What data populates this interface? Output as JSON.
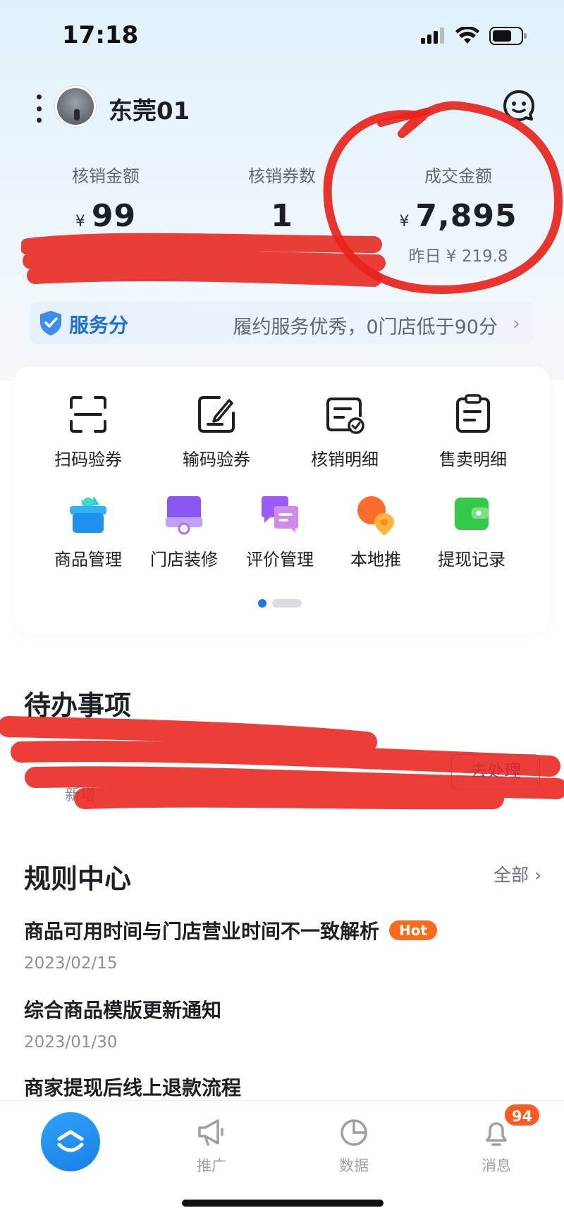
{
  "status_bar": {
    "time": "17:18",
    "icons": [
      "signal-icon",
      "wifi-icon",
      "battery-icon"
    ]
  },
  "header": {
    "store_name": "东莞01",
    "menu_icon": "more-vertical-icon",
    "support_icon": "customer-service-icon"
  },
  "stats": {
    "currency_symbol": "¥",
    "redeemed_amount": {
      "label": "核销金额",
      "value": "99"
    },
    "redeemed_coupons": {
      "label": "核销券数",
      "value": "1"
    },
    "deal_amount": {
      "label": "成交金额",
      "value": "7,895",
      "yesterday": "昨日 ¥ 219.8"
    }
  },
  "service_score": {
    "label": "服务分",
    "description": "履约服务优秀，0门店低于90分",
    "arrow": "›"
  },
  "tools": {
    "row1": [
      {
        "label": "扫码验券",
        "icon": "scan-icon"
      },
      {
        "label": "输码验券",
        "icon": "edit-code-icon"
      },
      {
        "label": "核销明细",
        "icon": "redeem-detail-icon"
      },
      {
        "label": "售卖明细",
        "icon": "clipboard-icon"
      }
    ],
    "row2": [
      {
        "label": "商品管理",
        "icon": "product-basket-icon"
      },
      {
        "label": "门店装修",
        "icon": "store-decor-icon"
      },
      {
        "label": "评价管理",
        "icon": "review-chat-icon"
      },
      {
        "label": "本地推",
        "icon": "local-promo-icon"
      },
      {
        "label": "提现记录",
        "icon": "wallet-icon"
      }
    ],
    "pager": {
      "pages": 2,
      "active": 1
    }
  },
  "todo": {
    "title": "待办事项",
    "partial_text": "新增",
    "action_button": "去处理"
  },
  "rules": {
    "title": "规则中心",
    "all_link": "全部",
    "all_arrow": "›",
    "items": [
      {
        "title": "商品可用时间与门店营业时间不一致解析",
        "date": "2023/02/15",
        "badge": "Hot"
      },
      {
        "title": "综合商品模版更新通知",
        "date": "2023/01/30"
      },
      {
        "title": "商家提现后线上退款流程"
      }
    ]
  },
  "tab_bar": {
    "tabs": [
      {
        "label": "",
        "icon": "home-logo-icon"
      },
      {
        "label": "推广",
        "icon": "megaphone-icon"
      },
      {
        "label": "数据",
        "icon": "pie-chart-icon"
      },
      {
        "label": "消息",
        "icon": "bell-icon"
      }
    ],
    "message_badge": "94"
  },
  "colors": {
    "accent_blue": "#1f7ae0",
    "hot_orange": "#ff6a1a",
    "badge_orange": "#ff5a1f",
    "scribble_red": "#e8231c"
  }
}
